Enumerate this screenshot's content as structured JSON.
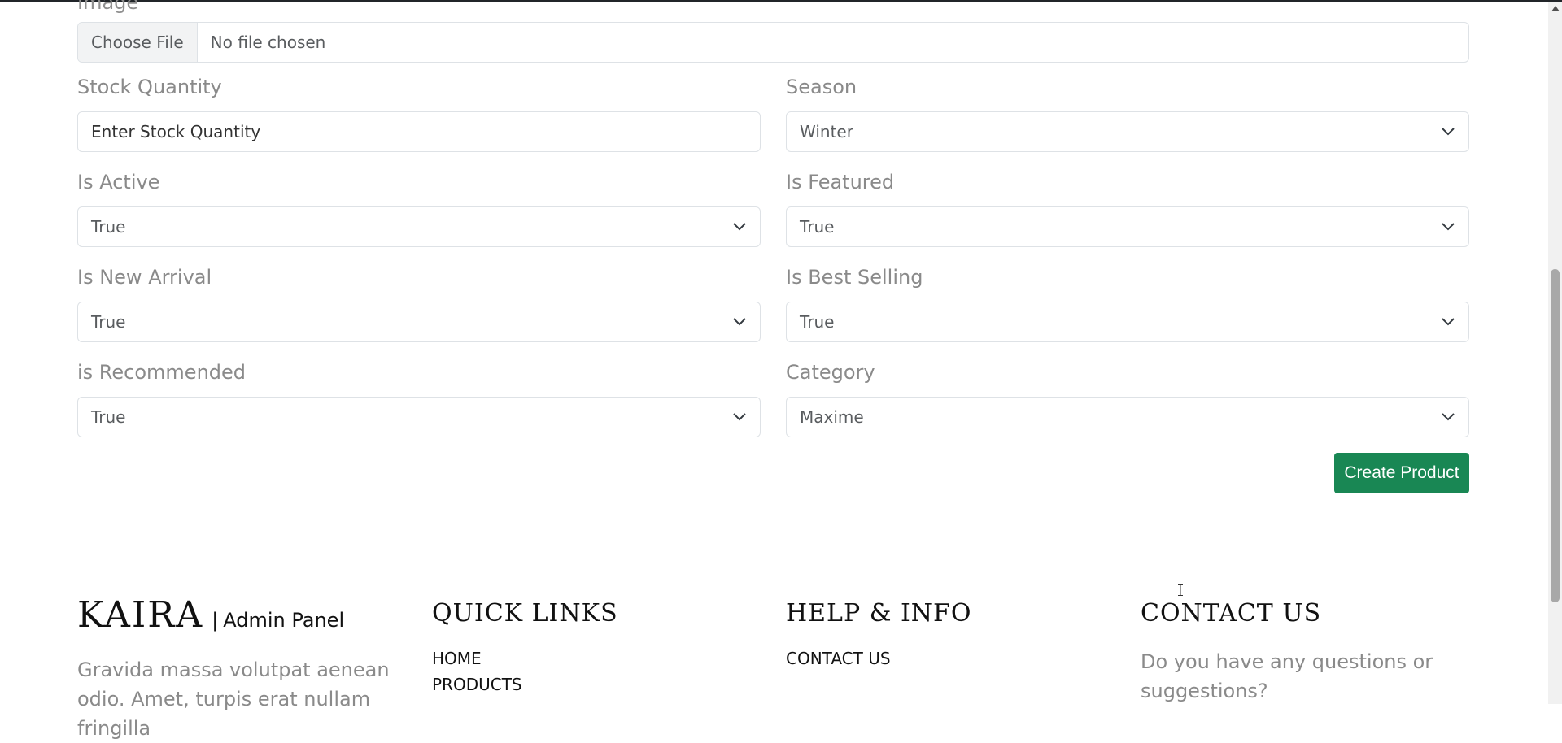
{
  "form": {
    "image_label": "Image",
    "file_button": "Choose File",
    "file_status": "No file chosen",
    "stock_quantity": {
      "label": "Stock Quantity",
      "placeholder": "Enter Stock Quantity"
    },
    "season": {
      "label": "Season",
      "value": "Winter"
    },
    "is_active": {
      "label": "Is Active",
      "value": "True"
    },
    "is_featured": {
      "label": "Is Featured",
      "value": "True"
    },
    "is_new_arrival": {
      "label": "Is New Arrival",
      "value": "True"
    },
    "is_best_selling": {
      "label": "Is Best Selling",
      "value": "True"
    },
    "is_recommended": {
      "label": "is Recommended",
      "value": "True"
    },
    "category": {
      "label": "Category",
      "value": "Maxime"
    },
    "submit_label": "Create Product"
  },
  "footer": {
    "logo": "KAIRA",
    "logo_sep": "|",
    "logo_sub": "Admin Panel",
    "description": "Gravida massa volutpat aenean odio. Amet, turpis erat nullam fringilla",
    "quick_links": {
      "heading": "QUICK LINKS",
      "items": [
        "HOME",
        "PRODUCTS"
      ]
    },
    "help_info": {
      "heading": "HELP & INFO",
      "items": [
        "CONTACT US"
      ]
    },
    "contact": {
      "heading": "CONTACT US",
      "text": "Do you have any questions or suggestions?"
    }
  },
  "icons": {
    "dropdown": "chevron-down-icon",
    "cursor": "text-cursor-icon"
  },
  "colors": {
    "accent": "#198754",
    "muted_text": "#8a8a8a",
    "border": "#dee2e6"
  }
}
